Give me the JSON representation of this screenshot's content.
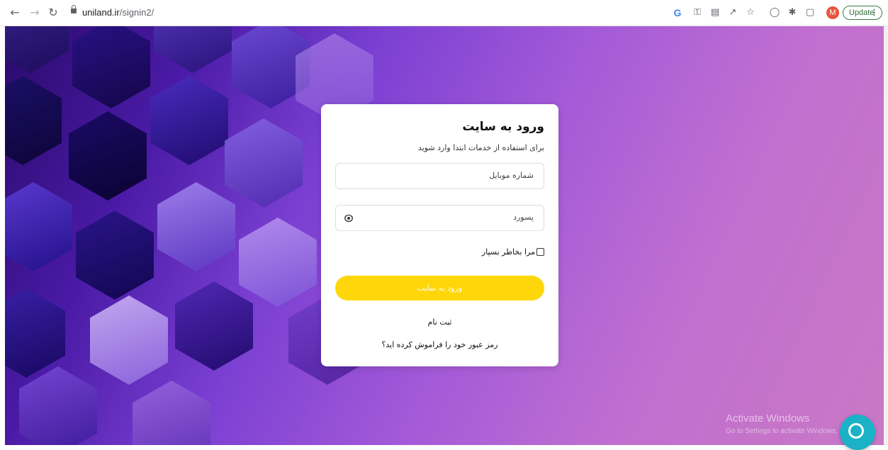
{
  "browser": {
    "url_host": "uniland.ir",
    "url_path": "/signin2/",
    "update_label": "Update",
    "avatar_letter": "M"
  },
  "login": {
    "title": "ورود به سایت",
    "subtitle": "برای استفاده از خدمات ابتدا وارد شوید",
    "mobile_placeholder": "شماره موبایل",
    "password_placeholder": "پسورد",
    "remember_label": "مرا بخاطر بسپار",
    "submit_label": "ورود به سایت",
    "register_label": "ثبت نام",
    "forgot_label": "رمز عبور خود را فراموش کرده اید؟",
    "submit_color": "#ffd60a"
  },
  "windows_watermark": {
    "line1": "Activate Windows",
    "line2": "Go to Settings to activate Windows."
  }
}
